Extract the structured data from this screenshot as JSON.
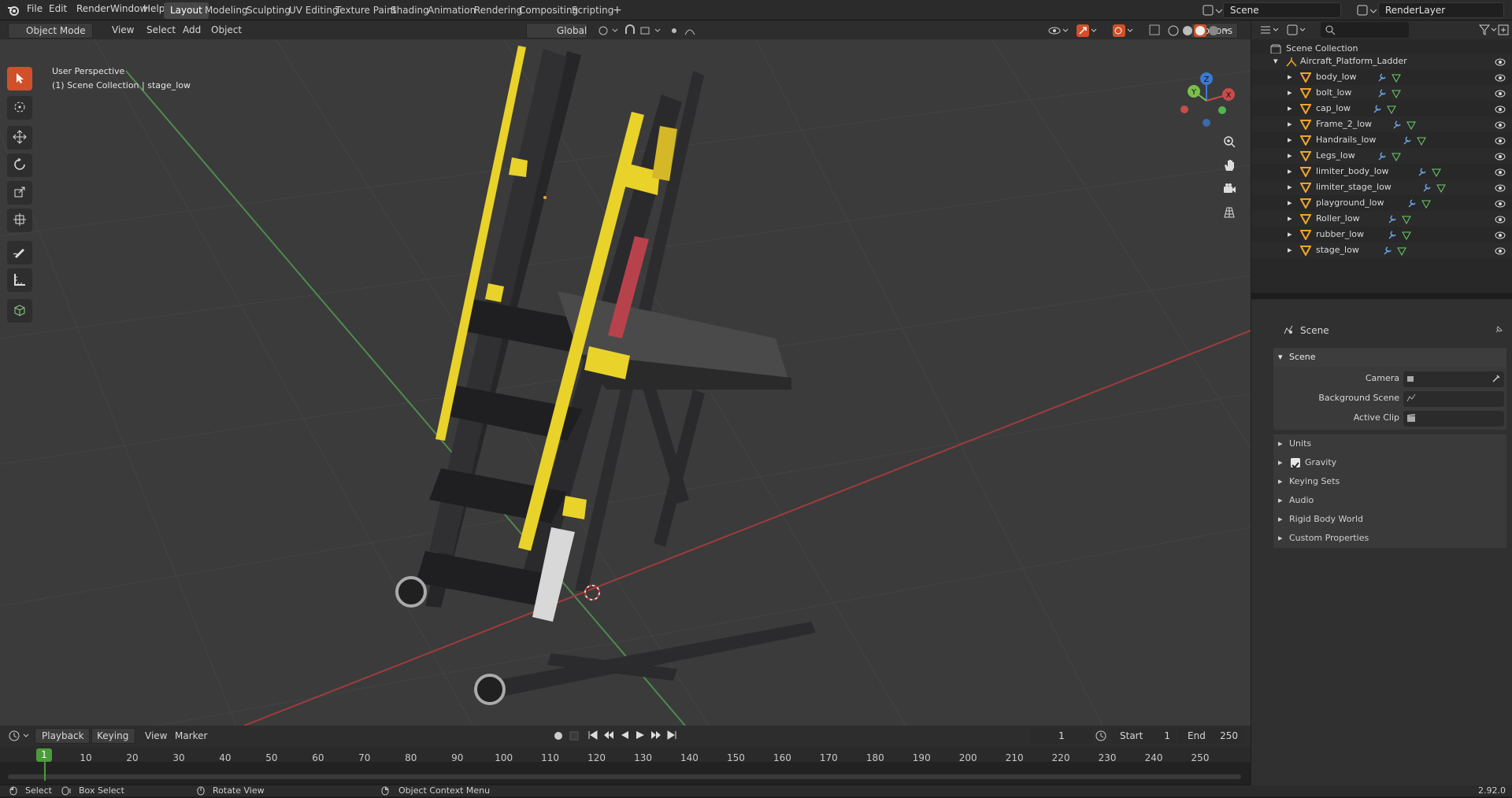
{
  "topbar": {
    "menus": [
      "File",
      "Edit",
      "Render",
      "Window",
      "Help"
    ],
    "workspaces": [
      "Layout",
      "Modeling",
      "Sculpting",
      "UV Editing",
      "Texture Paint",
      "Shading",
      "Animation",
      "Rendering",
      "Compositing",
      "Scripting"
    ],
    "active_workspace": "Layout",
    "add_tab": "+",
    "scene_name": "Scene",
    "render_layer": "RenderLayer"
  },
  "viewport_header": {
    "mode": "Object Mode",
    "menus": [
      "View",
      "Select",
      "Add",
      "Object"
    ],
    "orientation": "Global",
    "options": "Options"
  },
  "viewport": {
    "perspective": "User Perspective",
    "collection_info": "(1) Scene Collection | stage_low",
    "gizmo_axes": {
      "z": "Z",
      "y": "Y",
      "x": "X"
    },
    "colors": {
      "background": "#3b3b3b",
      "grid": "#444444",
      "x_axis": "#a03c3c",
      "y_axis": "#4f8a4f",
      "yellow": "#e9d22a",
      "metal": "#2b2b2d"
    }
  },
  "outliner": {
    "root": "Scene Collection",
    "collection": "Aircraft_Platform_Ladder",
    "objects": [
      "body_low",
      "bolt_low",
      "cap_low",
      "Frame_2_low",
      "Handrails_low",
      "Legs_low",
      "limiter_body_low",
      "limiter_stage_low",
      "playground_low",
      "Roller_low",
      "rubber_low",
      "stage_low"
    ]
  },
  "properties": {
    "header_title": "Scene",
    "panel_title": "Scene",
    "fields": [
      {
        "label": "Camera"
      },
      {
        "label": "Background Scene"
      },
      {
        "label": "Active Clip"
      }
    ],
    "subpanels": [
      "Units",
      "Gravity",
      "Keying Sets",
      "Audio",
      "Rigid Body World",
      "Custom Properties"
    ],
    "gravity_checked": true
  },
  "timeline": {
    "menus": [
      "Playback",
      "Keying",
      "View",
      "Marker"
    ],
    "current_frame": "1",
    "start_label": "Start",
    "start": "1",
    "end_label": "End",
    "end": "250",
    "ticks": [
      "10",
      "20",
      "30",
      "40",
      "50",
      "60",
      "70",
      "80",
      "90",
      "100",
      "110",
      "120",
      "130",
      "140",
      "150",
      "160",
      "170",
      "180",
      "190",
      "200",
      "210",
      "220",
      "230",
      "240",
      "250"
    ],
    "playhead": "1"
  },
  "statusbar": {
    "select": "Select",
    "box_select": "Box Select",
    "rotate_view": "Rotate View",
    "context_menu": "Object Context Menu",
    "version": "2.92.0"
  }
}
